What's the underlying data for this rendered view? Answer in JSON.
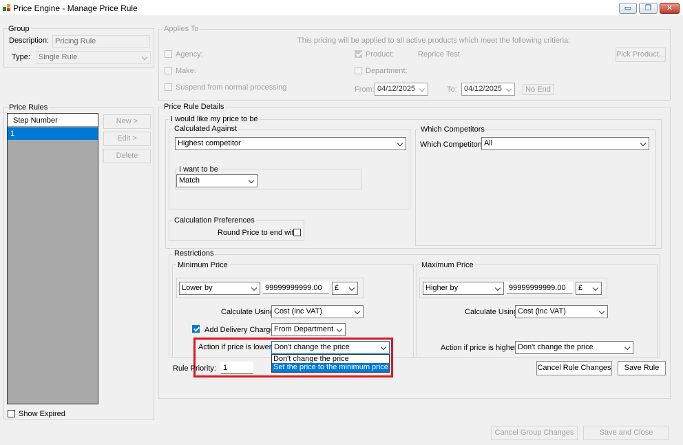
{
  "window": {
    "title": "Price Engine - Manage Price Rule",
    "minimize": "▭",
    "restore": "❐",
    "close": "✕"
  },
  "group": {
    "title": "Group",
    "description_label": "Description:",
    "description_value": "Pricing Rule",
    "type_label": "Type:",
    "type_value": "Single Rule"
  },
  "applies_to": {
    "title": "Applies To",
    "info": "This pricing will be applied to all active products which meet the following critieria:",
    "agency": "Agency:",
    "make": "Make:",
    "suspend": "Suspend from normal processing",
    "product": "Product:",
    "product_value": "Reprice Test",
    "department": "Department:",
    "pick_product": "Pick Product...",
    "from_label": "From:",
    "from_value": "04/12/2025",
    "to_label": "To:",
    "to_value": "04/12/2025",
    "no_end": "No End"
  },
  "price_rules": {
    "title": "Price Rules",
    "column_header": "Step Number",
    "rows": [
      "1"
    ],
    "new": "New >",
    "edit": "Edit >",
    "delete": "Delete",
    "show_expired": "Show Expired"
  },
  "details": {
    "title": "Price Rule Details",
    "like_title": "I would like my price to be",
    "calculated_against_title": "Calculated Against",
    "calculated_against_value": "Highest competitor",
    "want_title": "I want to be",
    "want_value": "Match",
    "competitors_title": "Which Competitors",
    "competitors_label": "Which Competitors:",
    "competitors_value": "All",
    "calc_pref_title": "Calculation Preferences",
    "round_price": "Round Price to end with",
    "restrictions_title": "Restrictions",
    "min": {
      "title": "Minimum Price",
      "mode": "Lower by",
      "amount": "99999999999.00",
      "currency": "£",
      "calc_using_label": "Calculate Using:",
      "calc_using_value": "Cost (inc VAT)",
      "delivery_label": "Add Delivery Charge",
      "delivery_value": "From Department",
      "action_label": "Action if price is lower:",
      "action_value": "Don't change the price",
      "dropdown_options": [
        "Don't change the price",
        "Set the price to the minimum price"
      ]
    },
    "max": {
      "title": "Maximum Price",
      "mode": "Higher by",
      "amount": "99999999999.00",
      "currency": "£",
      "calc_using_label": "Calculate Using:",
      "calc_using_value": "Cost (inc VAT)",
      "action_label": "Action if price is higher:",
      "action_value": "Don't change the price"
    },
    "rule_priority_label": "Rule Priority:",
    "rule_priority_value": "1",
    "cancel_rule": "Cancel Rule Changes",
    "save_rule": "Save Rule"
  },
  "footer": {
    "cancel_group": "Cancel Group Changes",
    "save_close": "Save and Close"
  },
  "colors": {
    "highlight": "#0078d7",
    "annotation": "#e0141e"
  }
}
